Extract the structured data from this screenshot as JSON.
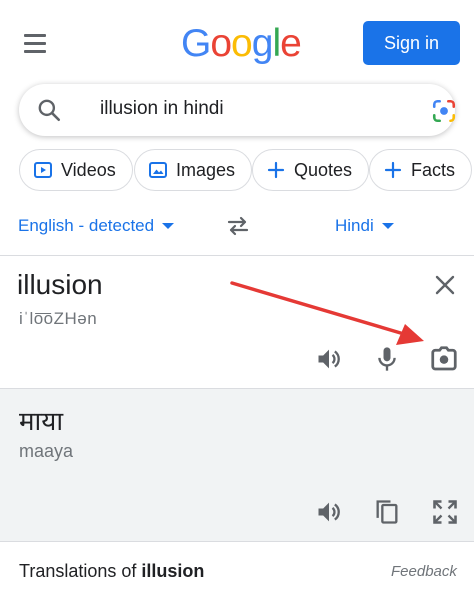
{
  "header": {
    "logo_letters": [
      {
        "ch": "G",
        "color": "#4285F4"
      },
      {
        "ch": "o",
        "color": "#EA4335"
      },
      {
        "ch": "o",
        "color": "#FBBC05"
      },
      {
        "ch": "g",
        "color": "#4285F4"
      },
      {
        "ch": "l",
        "color": "#34A853"
      },
      {
        "ch": "e",
        "color": "#EA4335"
      }
    ],
    "signin_label": "Sign in",
    "menu_icon": "hamburger-menu-icon"
  },
  "search": {
    "query": "illusion in hindi",
    "search_icon": "search-icon",
    "lens_icon": "google-lens-icon"
  },
  "chips": [
    {
      "label": "Videos",
      "icon": "video-icon"
    },
    {
      "label": "Images",
      "icon": "image-icon"
    },
    {
      "label": "Quotes",
      "icon": "plus-icon"
    },
    {
      "label": "Facts",
      "icon": "plus-icon"
    }
  ],
  "translator": {
    "source_lang": "English - detected",
    "target_lang": "Hindi",
    "source_text": "illusion",
    "source_phonetic": "iˈlo͞oZHən",
    "target_text": "माया",
    "target_transliteration": "maaya"
  },
  "footer": {
    "translations_prefix": "Translations of ",
    "translations_word": "illusion",
    "feedback": "Feedback"
  },
  "colors": {
    "accent": "#1a73e8",
    "annotation_arrow": "#e53935",
    "panel_bg": "#f1f3f4"
  }
}
